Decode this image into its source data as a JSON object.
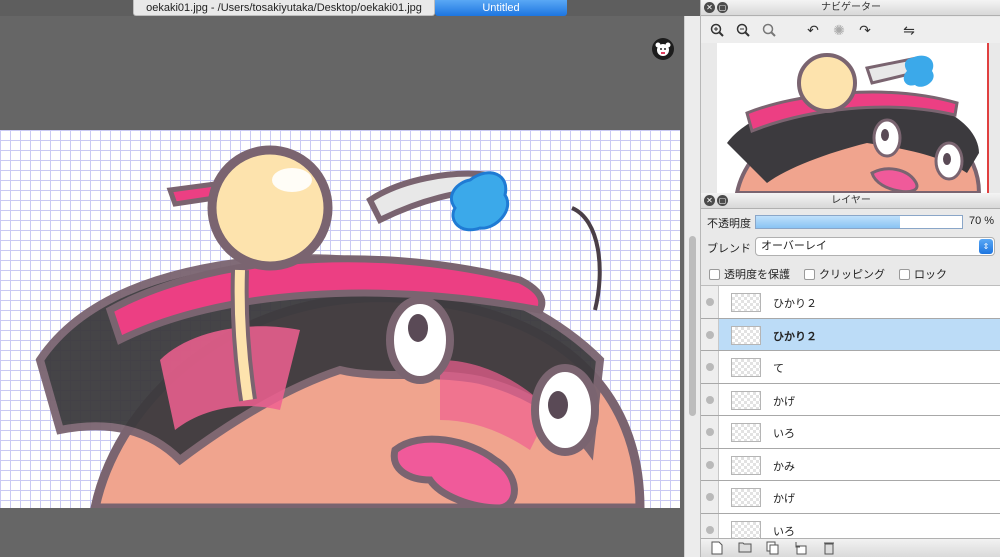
{
  "tabs": [
    {
      "label": "oekaki01.jpg - /Users/tosakiyutaka/Desktop/oekaki01.jpg",
      "active": false
    },
    {
      "label": "Untitled",
      "active": true
    }
  ],
  "navigator": {
    "title": "ナビゲーター",
    "toolbar_icons": [
      "zoom-in-icon",
      "zoom-out-icon",
      "zoom-reset-icon",
      "rotate-left-icon",
      "rotate-reset-icon",
      "rotate-right-icon",
      "flip-horizontal-icon"
    ]
  },
  "layers_panel": {
    "title": "レイヤー",
    "opacity_label": "不透明度",
    "opacity_value": "70 %",
    "opacity_fraction": 0.7,
    "blend_label": "ブレンド",
    "blend_value": "オーバーレイ",
    "checkboxes": {
      "protect_alpha": "透明度を保護",
      "clipping": "クリッピング",
      "lock": "ロック"
    },
    "layers": [
      {
        "name": "ひかり２",
        "selected": false
      },
      {
        "name": "ひかり２",
        "selected": true
      },
      {
        "name": "て",
        "selected": false
      },
      {
        "name": "かげ",
        "selected": false
      },
      {
        "name": "いろ",
        "selected": false
      },
      {
        "name": "かみ",
        "selected": false
      },
      {
        "name": "かげ",
        "selected": false
      },
      {
        "name": "いろ",
        "selected": false
      }
    ],
    "bottom_icons": [
      "new-layer-icon",
      "new-folder-icon",
      "duplicate-layer-icon",
      "merge-layer-icon",
      "delete-layer-icon"
    ]
  },
  "colors": {
    "tab_active": "#1d75e0",
    "selection": "#bcdcf7",
    "grid_major": "#7f7fd9",
    "grid_minor": "#c9c9f3"
  }
}
